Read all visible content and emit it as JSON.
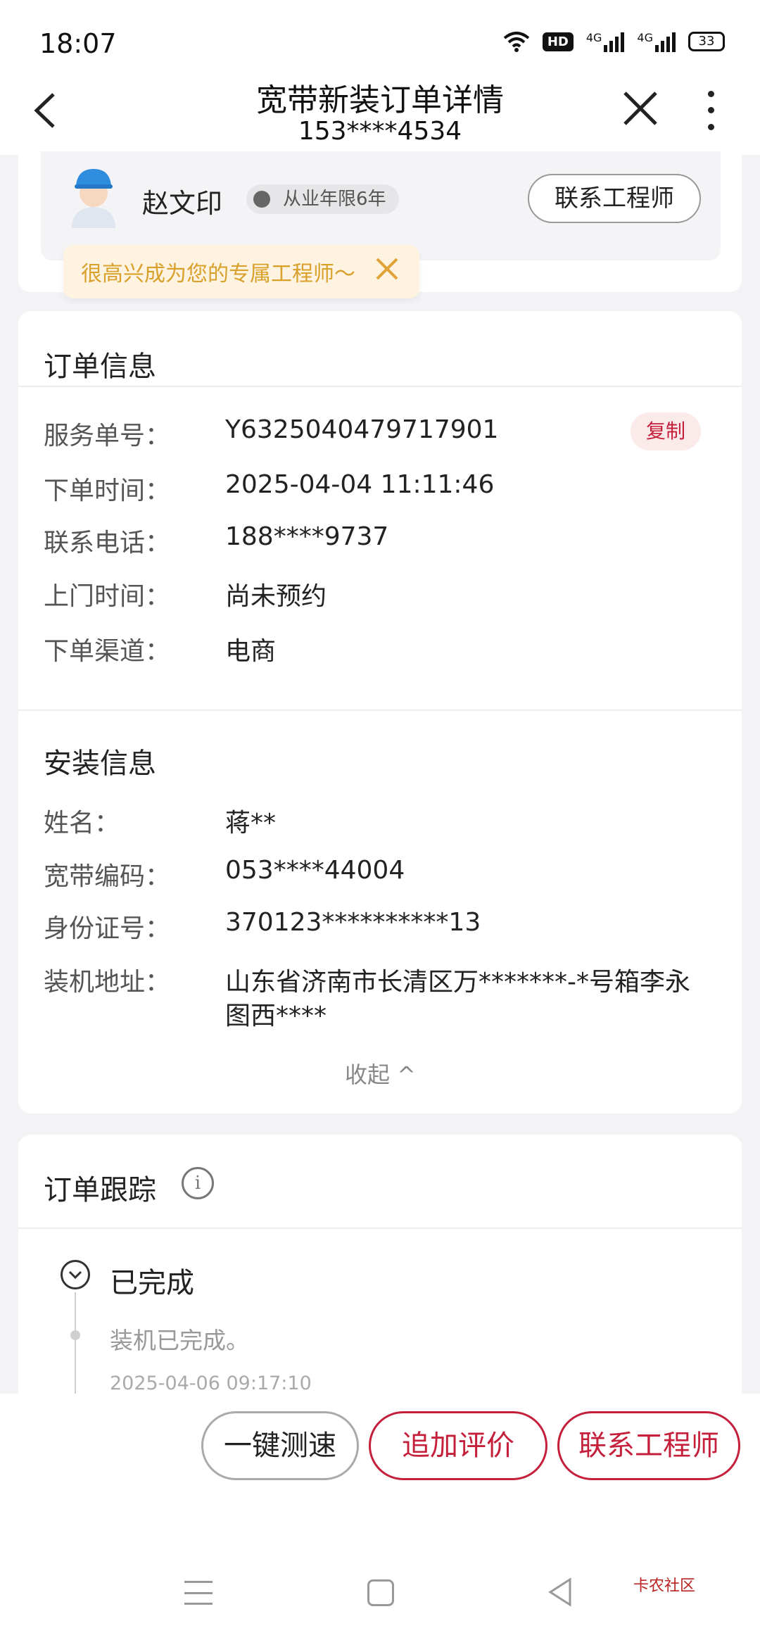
{
  "status": {
    "time": "18:07",
    "battery": "33"
  },
  "header": {
    "title": "宽带新装订单详情",
    "subtitle": "153****4534"
  },
  "engineer": {
    "name": "赵文印",
    "badge": "从业年限6年",
    "contact_label": "联系工程师",
    "tip": "很高兴成为您的专属工程师～"
  },
  "order_info": {
    "title": "订单信息",
    "copy_label": "复制",
    "rows": [
      {
        "label": "服务单号：",
        "value": "Y6325040479717901"
      },
      {
        "label": "下单时间：",
        "value": "2025-04-04 11:11:46"
      },
      {
        "label": "联系电话：",
        "value": "188****9737"
      },
      {
        "label": "上门时间：",
        "value": "尚未预约"
      },
      {
        "label": "下单渠道：",
        "value": "电商"
      }
    ]
  },
  "install_info": {
    "title": "安装信息",
    "rows": [
      {
        "label": "姓名：",
        "value": "蒋**"
      },
      {
        "label": "宽带编码：",
        "value": "053****44004"
      },
      {
        "label": "身份证号：",
        "value": "370123**********13"
      },
      {
        "label": "装机地址：",
        "value": "山东省济南市长清区万*******-*号箱李永",
        "value2": "图西****"
      }
    ],
    "collapse_label": "收起 ^"
  },
  "tracking": {
    "title": "订单跟踪",
    "status": "已完成",
    "event": "装机已完成。",
    "event_time": "2025-04-06 09:17:10"
  },
  "actions": {
    "speed_test": "一键测速",
    "add_review": "追加评价",
    "contact": "联系工程师"
  },
  "watermark": "卡农社区"
}
